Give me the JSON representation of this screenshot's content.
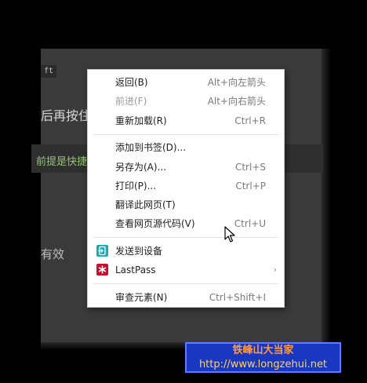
{
  "background": {
    "code_chip": "ft",
    "text_1": "后再按住",
    "text_2": "前提是快捷键",
    "text_3": "有效"
  },
  "menu": {
    "items": [
      {
        "label": "返回(B)",
        "shortcut": "Alt+向左箭头",
        "disabled": false
      },
      {
        "label": "前进(F)",
        "shortcut": "Alt+向右箭头",
        "disabled": true
      },
      {
        "label": "重新加载(R)",
        "shortcut": "Ctrl+R",
        "disabled": false
      },
      {
        "label": "添加到书签(D)...",
        "shortcut": "",
        "disabled": false
      },
      {
        "label": "另存为(A)...",
        "shortcut": "Ctrl+S",
        "disabled": false
      },
      {
        "label": "打印(P)...",
        "shortcut": "Ctrl+P",
        "disabled": false
      },
      {
        "label": "翻译此网页(T)",
        "shortcut": "",
        "disabled": false
      },
      {
        "label": "查看网页源代码(V)",
        "shortcut": "Ctrl+U",
        "disabled": false
      },
      {
        "label": "发送到设备",
        "shortcut": "",
        "disabled": false,
        "icon": "send-to-device-icon"
      },
      {
        "label": "LastPass",
        "shortcut": "",
        "disabled": false,
        "icon": "lastpass-icon",
        "submenu": true
      },
      {
        "label": "审查元素(N)",
        "shortcut": "Ctrl+Shift+I",
        "disabled": false
      }
    ],
    "submenu_arrow": "›"
  },
  "watermark": {
    "line1": "铁峰山大当家",
    "line2": "http://www.longzehui.net"
  },
  "colors": {
    "menu_bg": "#ffffff",
    "disabled_text": "#9b9b9b",
    "send_icon": "#1aa9b5",
    "lastpass_icon": "#c8102e",
    "watermark_bg": "#1a37c2"
  }
}
